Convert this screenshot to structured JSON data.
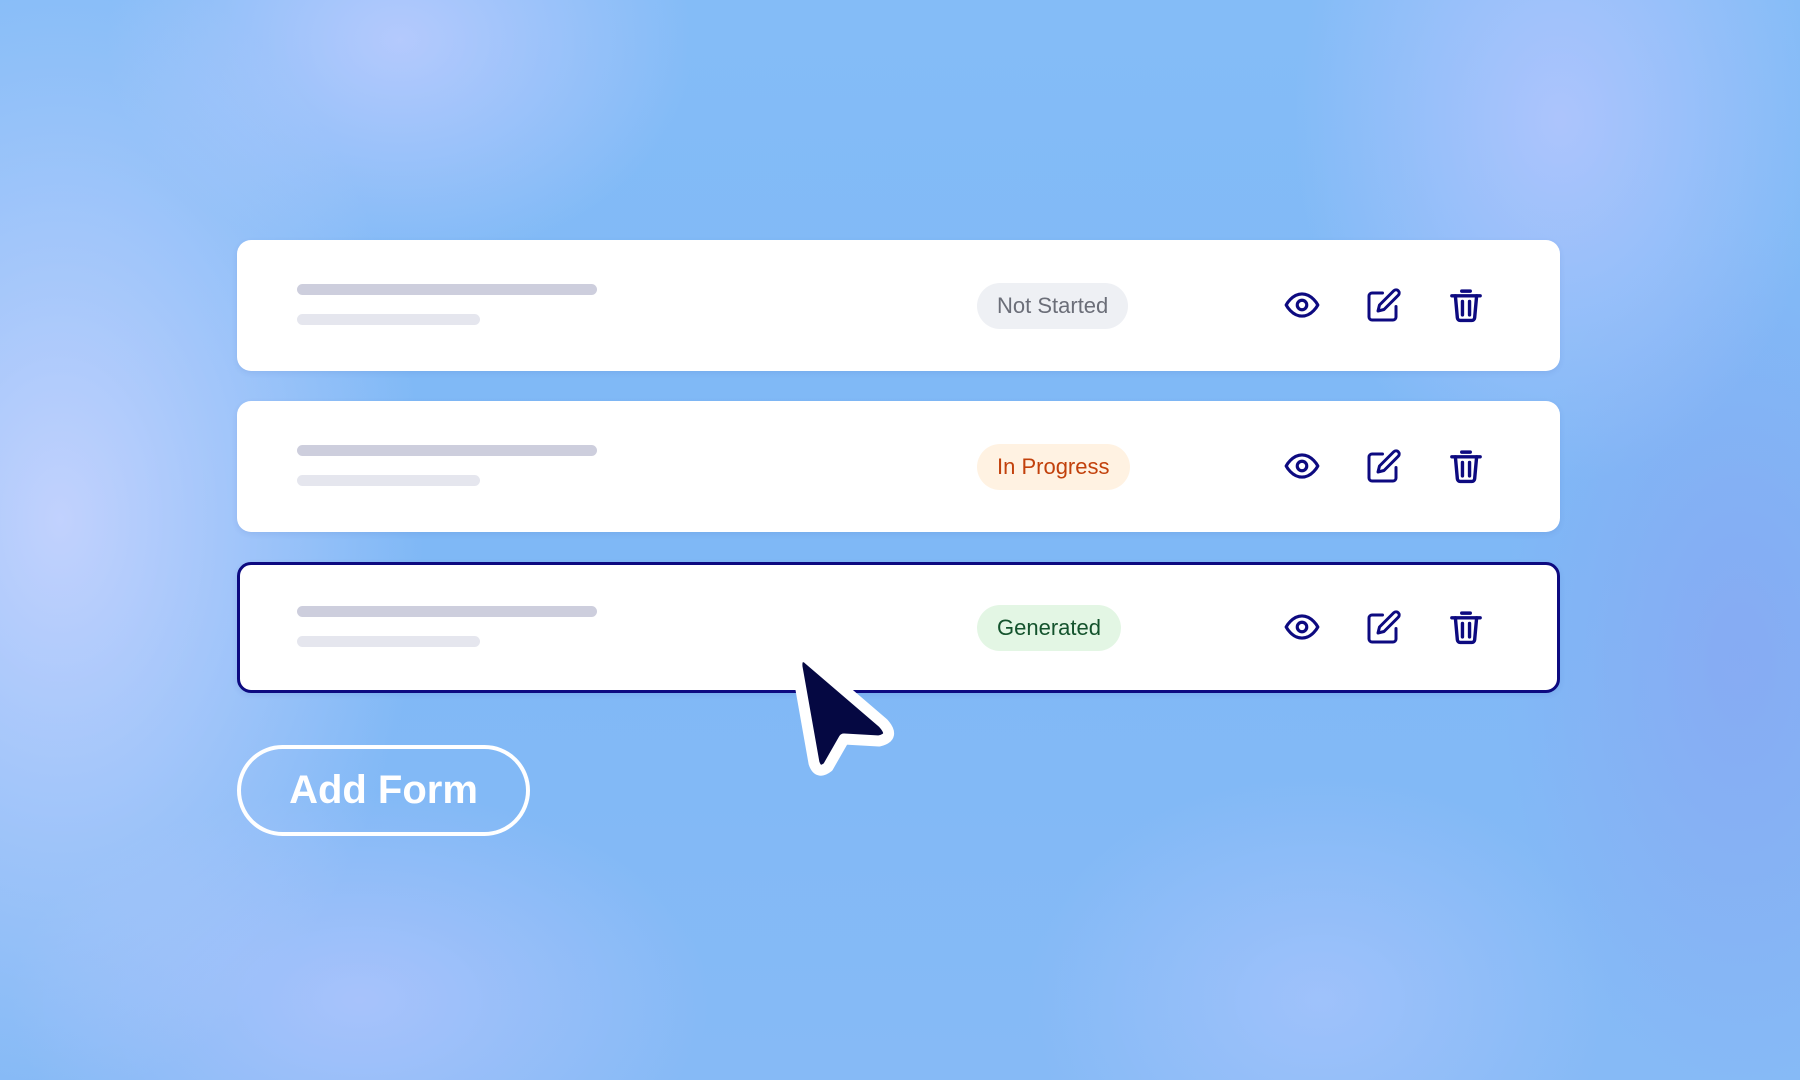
{
  "colors": {
    "accent": "#0d0a80",
    "icon": "#0d0a80",
    "cursor_fill": "#050842",
    "card_background": "#ffffff",
    "skeleton_primary": "#cdcedd",
    "skeleton_secondary": "#e5e6ee"
  },
  "forms": [
    {
      "status": "Not Started",
      "status_color": "#6b6e78",
      "status_background": "#eef0f4",
      "selected": false,
      "actions": [
        "eye-icon",
        "edit-icon",
        "trash-icon"
      ]
    },
    {
      "status": "In Progress",
      "status_color": "#c2410c",
      "status_background": "#fff2e2",
      "selected": false,
      "actions": [
        "eye-icon",
        "edit-icon",
        "trash-icon"
      ]
    },
    {
      "status": "Generated",
      "status_color": "#14532d",
      "status_background": "#e3f6e4",
      "selected": true,
      "actions": [
        "eye-icon",
        "edit-icon",
        "trash-icon"
      ]
    }
  ],
  "add_button": {
    "label": "Add Form"
  },
  "pointer": {
    "icon": "cursor-arrow-icon"
  }
}
